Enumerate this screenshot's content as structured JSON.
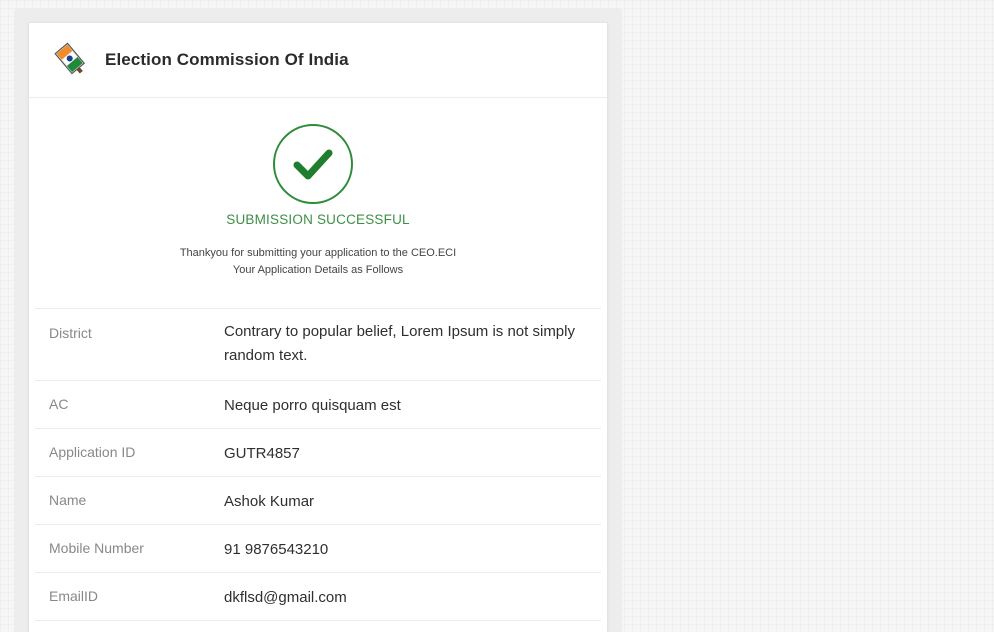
{
  "header": {
    "title": "Election Commission Of India"
  },
  "success": {
    "title": "SUBMISSION SUCCESSFUL",
    "message_line1": "Thankyou for submitting your application to the CEO.ECI",
    "message_line2": "Your Application Details as Follows"
  },
  "details": [
    {
      "label": "District",
      "value": "Contrary to popular belief, Lorem Ipsum is not simply random text."
    },
    {
      "label": "AC",
      "value": "Neque porro quisquam est"
    },
    {
      "label": "Application ID",
      "value": "GUTR4857"
    },
    {
      "label": "Name",
      "value": "Ashok Kumar"
    },
    {
      "label": "Mobile Number",
      "value": "91 9876543210"
    },
    {
      "label": "EmailID",
      "value": "dkflsd@gmail.com"
    }
  ],
  "colors": {
    "success_green": "#2e8b3a",
    "title_text": "#2b2b2b",
    "label_text": "#888888"
  },
  "icons": {
    "logo": "voting-ink-finger-logo",
    "status": "checkmark-circle-icon"
  }
}
